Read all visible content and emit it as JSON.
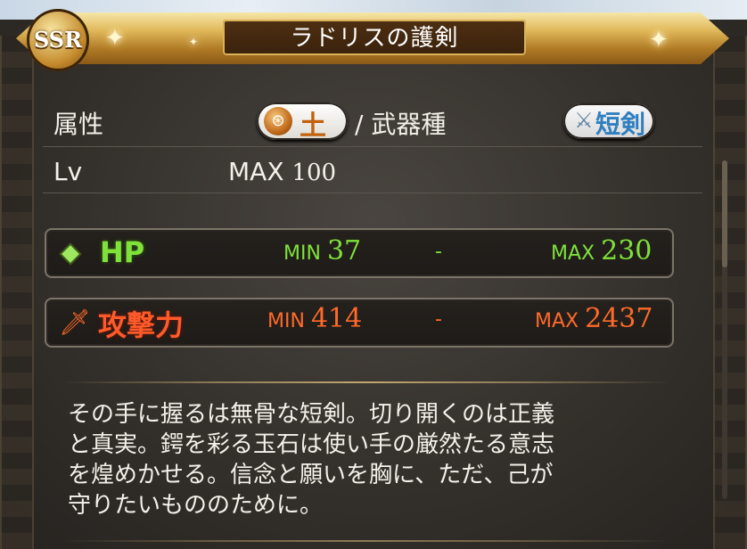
{
  "banner": {
    "rarity": "SSR",
    "weapon_name": "ラドリスの護剣"
  },
  "info": {
    "attribute_label": "属性",
    "attribute_value": "土",
    "weapon_type_label": "/ 武器種",
    "weapon_type_value": "短剣",
    "level_label": "Lv",
    "level_prefix": "MAX",
    "level_value": "100"
  },
  "stats": {
    "hp": {
      "name": "HP",
      "min_label": "MIN",
      "min_value": "37",
      "separator": "-",
      "max_label": "MAX",
      "max_value": "230"
    },
    "attack": {
      "name": "攻撃力",
      "min_label": "MIN",
      "min_value": "414",
      "separator": "-",
      "max_label": "MAX",
      "max_value": "2437"
    }
  },
  "description": {
    "line1": "その手に握るは無骨な短剣。切り開くのは正義",
    "line2": "と真実。鍔を彩る玉石は使い手の厳然たる意志",
    "line3": "を煌めかせる。信念と願いを胸に、ただ、己が",
    "line4": "守りたいもののために。"
  },
  "colors": {
    "hp": "#7fe23a",
    "attack": "#ff6a2a",
    "earth": "#c2620d",
    "dagger": "#2f7fbf"
  },
  "icons": {
    "earth": "earth-element-icon",
    "dagger": "dagger-icon",
    "hp": "diamond-icon",
    "attack": "sword-icon"
  }
}
